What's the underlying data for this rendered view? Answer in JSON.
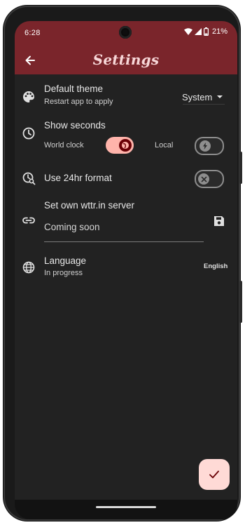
{
  "status_bar": {
    "time": "6:28",
    "battery": "21%"
  },
  "app_bar": {
    "title": "Settings"
  },
  "settings": {
    "default_theme": {
      "label": "Default theme",
      "subtitle": "Restart app to apply",
      "value": "System"
    },
    "show_seconds": {
      "label": "Show seconds",
      "world_clock_label": "World clock",
      "world_clock_enabled": true,
      "local_label": "Local",
      "local_enabled": false
    },
    "use_24hr": {
      "label": "Use 24hr format",
      "enabled": false
    },
    "wttr_server": {
      "label": "Set own wttr.in server",
      "placeholder": "Coming soon"
    },
    "language": {
      "label": "Language",
      "subtitle": "In progress",
      "value": "English"
    }
  },
  "colors": {
    "app_bar": "#7a252b",
    "title": "#f7d7d8",
    "background": "#222222",
    "switch_on_track": "#ffb4ab",
    "switch_on_thumb": "#690005",
    "fab": "#ffdad6"
  },
  "icons": {
    "back": "arrow-left-icon",
    "theme": "palette-icon",
    "seconds": "clock-icon",
    "format": "clock-search-icon",
    "server": "link-icon",
    "save": "save-icon",
    "language": "globe-icon",
    "fab": "check-icon"
  }
}
